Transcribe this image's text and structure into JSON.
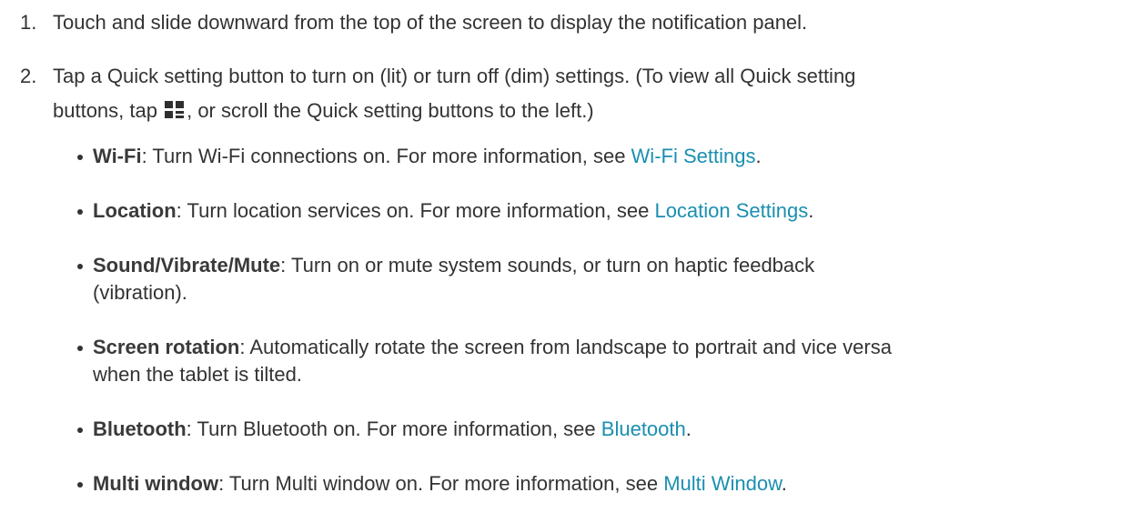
{
  "steps": [
    {
      "number": "1.",
      "text": "Touch and slide downward from the top of the screen to display the notification panel."
    },
    {
      "number": "2.",
      "text_before_icon": "Tap a Quick setting button to turn on (lit) or turn off (dim) settings. (To view all Quick setting",
      "text_line2_before_icon": "buttons, tap ",
      "icon": "quick-settings-grid-icon",
      "text_after_icon": ", or scroll the Quick setting buttons to the left.)"
    }
  ],
  "bullets": [
    {
      "term": "Wi-Fi",
      "desc": ": Turn Wi-Fi connections on. For more information, see ",
      "link": "Wi-Fi Settings",
      "end": "."
    },
    {
      "term": "Location",
      "desc": ": Turn location services on. For more information, see ",
      "link": "Location Settings",
      "end": "."
    },
    {
      "term": "Sound/Vibrate/Mute",
      "desc_line1": ": Turn on or mute system sounds, or turn on haptic feedback",
      "desc_line2": "(vibration)."
    },
    {
      "term": "Screen rotation",
      "desc_line1": ": Automatically rotate the screen from landscape to portrait and vice versa",
      "desc_line2": "when the tablet is tilted."
    },
    {
      "term": "Bluetooth",
      "desc": ": Turn Bluetooth on. For more information, see ",
      "link": "Bluetooth",
      "end": "."
    },
    {
      "term": "Multi window",
      "desc": ": Turn Multi window on. For more information, see ",
      "link": "Multi Window",
      "end": "."
    }
  ],
  "colors": {
    "text": "#333333",
    "link": "#1a8fb0",
    "background": "#ffffff"
  }
}
